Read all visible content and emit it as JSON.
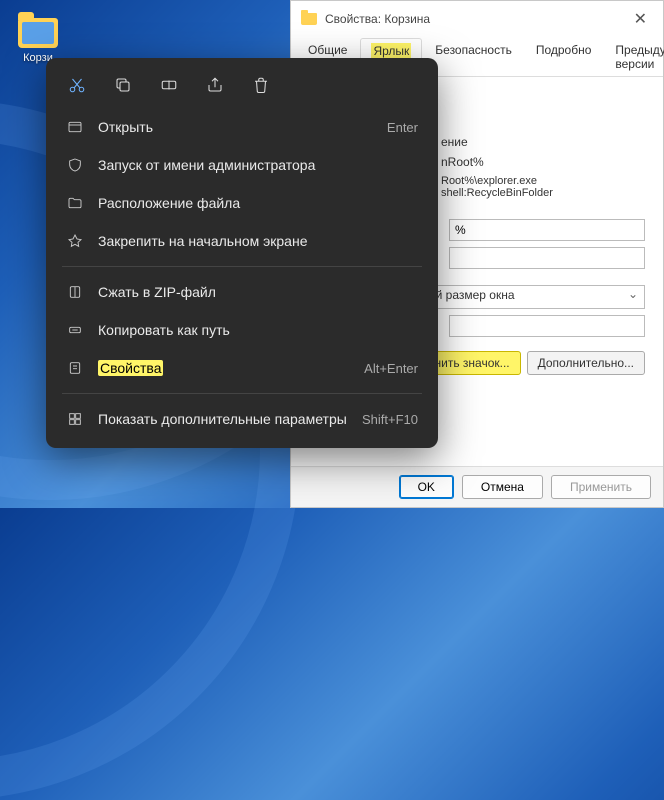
{
  "desktop": {
    "icon_label": "Корзи"
  },
  "properties_window": {
    "title": "Свойства: Корзина",
    "tabs": {
      "general": "Общие",
      "shortcut": "Ярлык",
      "security": "Безопасность",
      "details": "Подробно",
      "previous": "Предыдущие версии"
    },
    "fields": {
      "type_label_partial": "ение",
      "location_partial": "nRoot%",
      "target_partial": "Root%\\explorer.exe shell:RecycleBinFolder",
      "start_in_partial": "%",
      "shortcut_key": "",
      "run_partial": "ый размер окна",
      "comment": ""
    },
    "buttons": {
      "change_icon": "Сменить значок...",
      "advanced": "Дополнительно..."
    },
    "bottom": {
      "ok": "OK",
      "cancel": "Отмена",
      "apply": "Применить"
    }
  },
  "context_menu": {
    "items": {
      "open": {
        "label": "Открыть",
        "shortcut": "Enter"
      },
      "run_as_admin": {
        "label": "Запуск от имени администратора"
      },
      "file_location": {
        "label": "Расположение файла"
      },
      "pin_start": {
        "label": "Закрепить на начальном экране"
      },
      "zip": {
        "label": "Сжать в ZIP-файл"
      },
      "copy_path": {
        "label": "Копировать как путь"
      },
      "properties": {
        "label": "Свойства",
        "shortcut": "Alt+Enter"
      },
      "more": {
        "label": "Показать дополнительные параметры",
        "shortcut": "Shift+F10"
      }
    },
    "icon_bar": [
      "cut",
      "copy",
      "rename",
      "share",
      "delete"
    ]
  }
}
